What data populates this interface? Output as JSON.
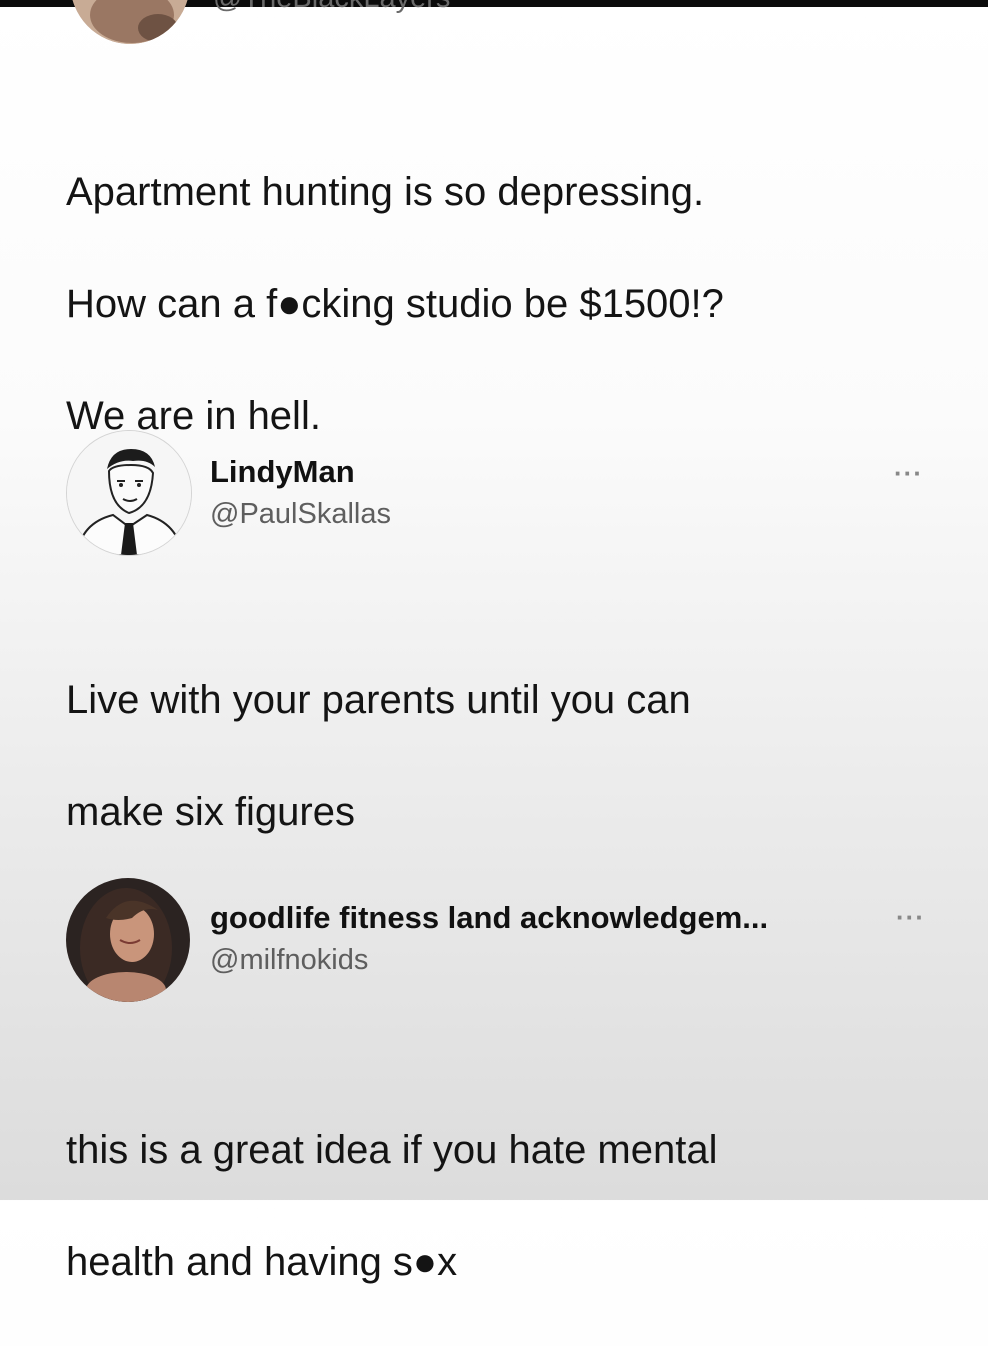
{
  "tweets": [
    {
      "handle": "@TheBlackLayers",
      "body": [
        "Apartment hunting is so depressing.",
        "How can a f●cking studio be $1500!?",
        "We are in hell."
      ]
    },
    {
      "name": "LindyMan",
      "handle": "@PaulSkallas",
      "more": "···",
      "body": [
        "Live with your parents until you can",
        "make six figures"
      ]
    },
    {
      "name": "goodlife fitness land acknowledgem...",
      "handle": "@milfnokids",
      "more": "···",
      "body": [
        "this is a great idea if you hate mental",
        "health and having s●x"
      ]
    }
  ],
  "colors": {
    "text": "#141414",
    "handle": "#5e5e5e",
    "background_top": "#ffffff",
    "background_bottom": "#dcdcdc"
  },
  "icons": [
    "avatar-photo",
    "avatar-cartoon-man",
    "avatar-woman-photo",
    "more-options-icon"
  ]
}
